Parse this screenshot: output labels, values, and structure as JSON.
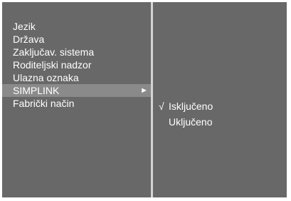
{
  "menu": {
    "items": [
      {
        "label": "Jezik"
      },
      {
        "label": "Država"
      },
      {
        "label": "Zaključav. sistema"
      },
      {
        "label": "Roditeljski nadzor"
      },
      {
        "label": "Ulazna oznaka"
      },
      {
        "label": "SIMPLINK",
        "selected": true,
        "arrow": "►"
      },
      {
        "label": "Fabrički način"
      }
    ]
  },
  "submenu": {
    "items": [
      {
        "label": "Isključeno",
        "checked": true,
        "check": "√"
      },
      {
        "label": "Uključeno",
        "checked": false
      }
    ]
  },
  "colors": {
    "background": "#686868",
    "highlight": "#8a8a8a",
    "divider": "#d4d4d4",
    "text": "#ffffff"
  }
}
